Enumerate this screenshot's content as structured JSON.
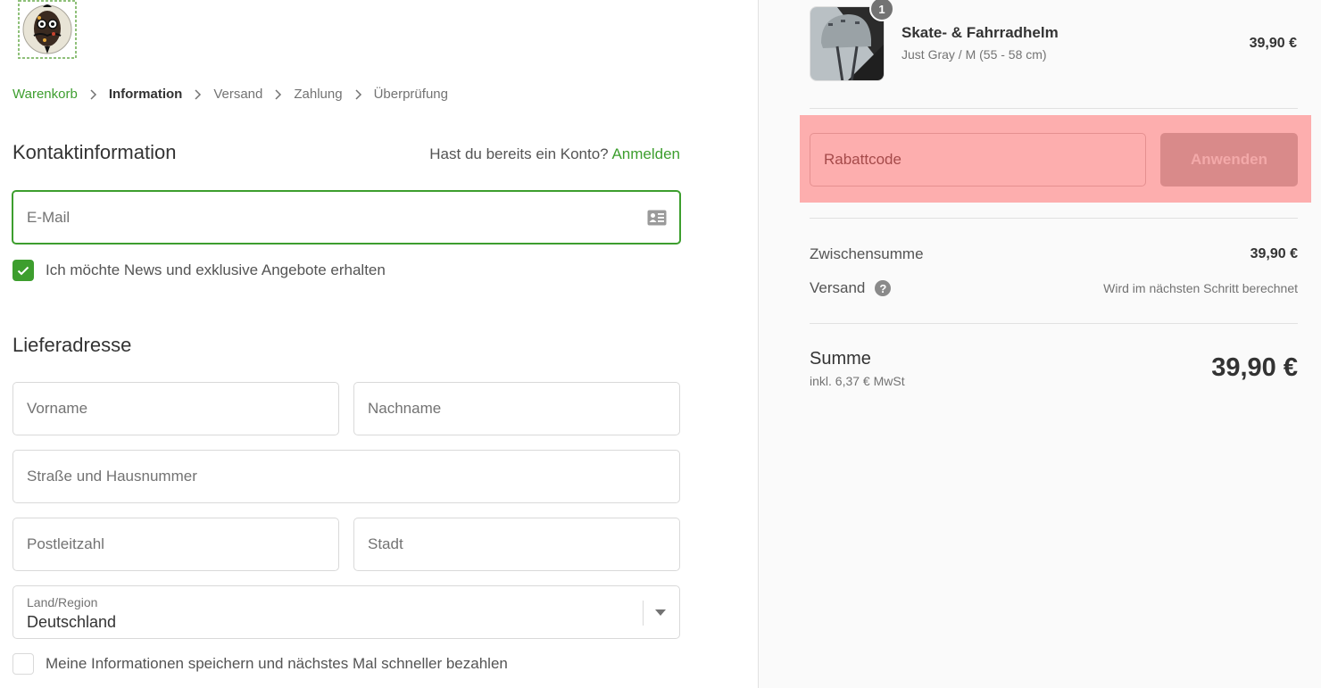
{
  "breadcrumb": [
    {
      "label": "Warenkorb",
      "state": "link"
    },
    {
      "label": "Information",
      "state": "current"
    },
    {
      "label": "Versand",
      "state": "upcoming"
    },
    {
      "label": "Zahlung",
      "state": "upcoming"
    },
    {
      "label": "Überprüfung",
      "state": "upcoming"
    }
  ],
  "contact": {
    "title": "Kontaktinformation",
    "login_prompt": "Hast du bereits ein Konto?",
    "login_link": "Anmelden",
    "email_placeholder": "E-Mail",
    "email_value": "",
    "newsletter_label": "Ich möchte News und exklusive Angebote erhalten",
    "newsletter_checked": true
  },
  "address": {
    "title": "Lieferadresse",
    "first_name_placeholder": "Vorname",
    "last_name_placeholder": "Nachname",
    "street_placeholder": "Straße und Hausnummer",
    "zip_placeholder": "Postleitzahl",
    "city_placeholder": "Stadt",
    "country_label": "Land/Region",
    "country_value": "Deutschland",
    "save_info_label": "Meine Informationen speichern und nächstes Mal schneller bezahlen",
    "save_info_checked": false
  },
  "order": {
    "item": {
      "name": "Skate- & Fahrradhelm",
      "variant": "Just Gray / M (55 - 58 cm)",
      "price": "39,90 €",
      "quantity": "1"
    },
    "discount": {
      "placeholder": "Rabattcode",
      "apply_label": "Anwenden"
    },
    "subtotal_label": "Zwischensumme",
    "subtotal_value": "39,90 €",
    "shipping_label": "Versand",
    "shipping_value": "Wird im nächsten Schritt berechnet",
    "total_label": "Summe",
    "tax_note": "inkl. 6,37 € MwSt",
    "total_value": "39,90 €"
  },
  "colors": {
    "accent": "#3d9e2e",
    "highlight": "#fdaeae"
  }
}
